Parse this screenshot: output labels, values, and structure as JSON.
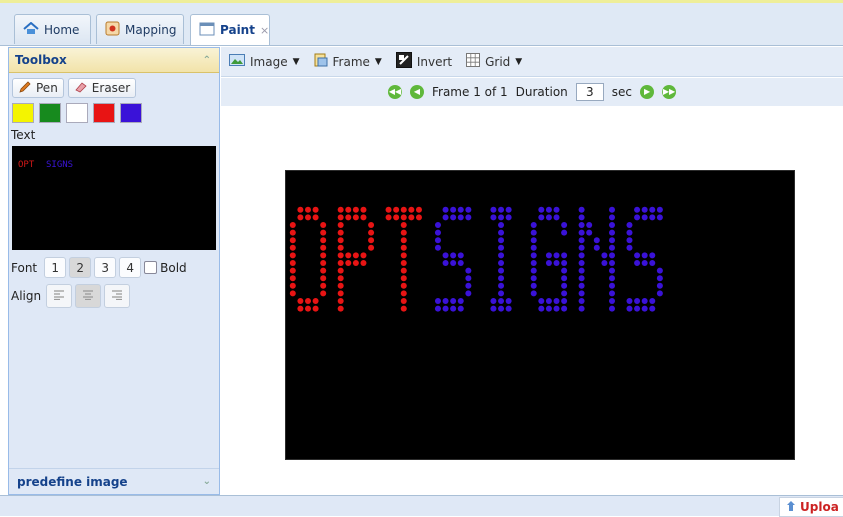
{
  "tabs": [
    {
      "label": "Home",
      "icon": "home-icon"
    },
    {
      "label": "Mapping",
      "icon": "mapping-icon"
    },
    {
      "label": "Paint",
      "icon": "paint-icon",
      "close": "×",
      "active": true
    }
  ],
  "toolbox": {
    "title": "Toolbox",
    "pen_label": "Pen",
    "eraser_label": "Eraser",
    "colors": [
      "#f4f400",
      "#178a1e",
      "#ffffff",
      "#e81414",
      "#3a12d8"
    ],
    "text_label": "Text",
    "preview_text": {
      "part1": "OPT",
      "part2": "SIGNS"
    },
    "font_label": "Font",
    "font_sizes": [
      "1",
      "2",
      "3",
      "4"
    ],
    "bold_label": "Bold",
    "align_label": "Align",
    "footer_label": "predefine image"
  },
  "toolbar": {
    "image_label": "Image",
    "frame_label": "Frame",
    "invert_label": "Invert",
    "grid_label": "Grid"
  },
  "frame": {
    "label": "Frame 1 of 1",
    "duration_label": "Duration",
    "duration_value": "3",
    "unit": "sec"
  },
  "sign": {
    "word1": "OPT",
    "word2": "SIGNS",
    "color1": "#e81414",
    "color2": "#3a12d8"
  },
  "status": {
    "upload_label": "Uploa"
  }
}
